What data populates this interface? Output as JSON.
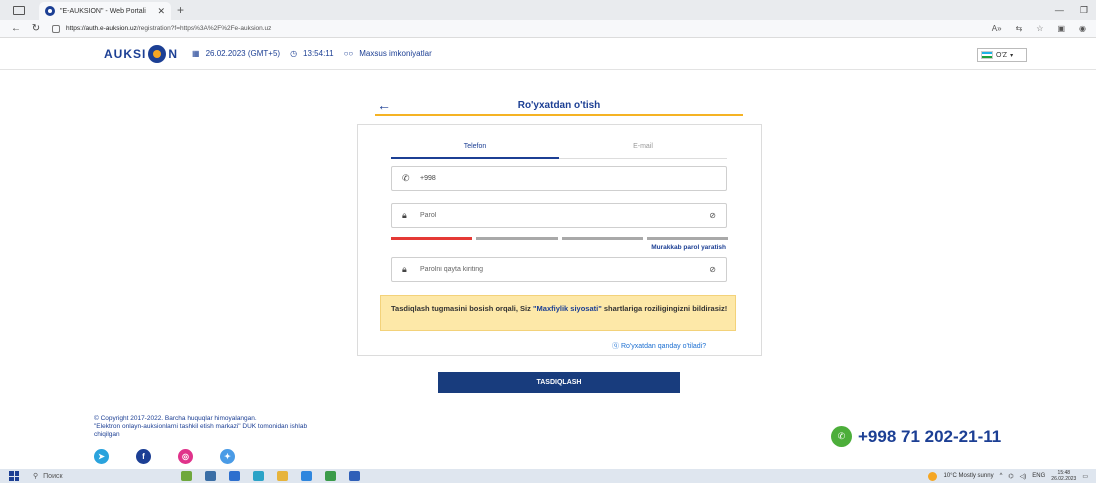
{
  "browser": {
    "tab_title": "\"E-AUKSION\" - Web Portali",
    "url_host": "https://auth.e-auksion.uz",
    "url_path": "/registration?f=https%3A%2F%2Fe-auksion.uz"
  },
  "header": {
    "logo_left": "AUKSI",
    "logo_right": "N",
    "date": "26.02.2023 (GMT+5)",
    "time": "13:54:11",
    "accessibility": "Maxsus imkoniyatlar",
    "language": "O'Z"
  },
  "form": {
    "title": "Ro'yxatdan o'tish",
    "tabs": [
      {
        "label": "Telefon"
      },
      {
        "label": "E-mail"
      }
    ],
    "phone_value": "+998",
    "password_placeholder": "Parol",
    "password_strength": 0.25,
    "generate_password": "Murakkab parol yaratish",
    "repeat_placeholder": "Parolni qayta kiriting",
    "notice_before": "Tasdiqlash tugmasini bosish orqali, Siz ",
    "notice_link": "\"Maxfiylik siyosati\"",
    "notice_after": " shartlariga roziligingizni bildirasiz!",
    "help_link": "Ro'yxatdan qanday o'tiladi?",
    "submit": "TASDIQLASH"
  },
  "footer": {
    "copyright_1": "© Copyright 2017-2022. Barcha huquqlar himoyalangan.",
    "copyright_2": "\"Elektron onlayn-auksionlarni tashkil etish markazi\" DUK tomonidan ishlab chiqilgan",
    "phone": "+998 71 202-21-11"
  },
  "taskbar": {
    "search_placeholder": "Поиск",
    "weather": "10°C Mostly sunny",
    "lang": "ENG",
    "clock_time": "15:48",
    "clock_date": "26.02.2023"
  },
  "colors": {
    "brand_blue": "#1c3f94",
    "accent_yellow": "#f5b324",
    "button_navy": "#183c7d",
    "notice_bg": "#fde8a8"
  }
}
